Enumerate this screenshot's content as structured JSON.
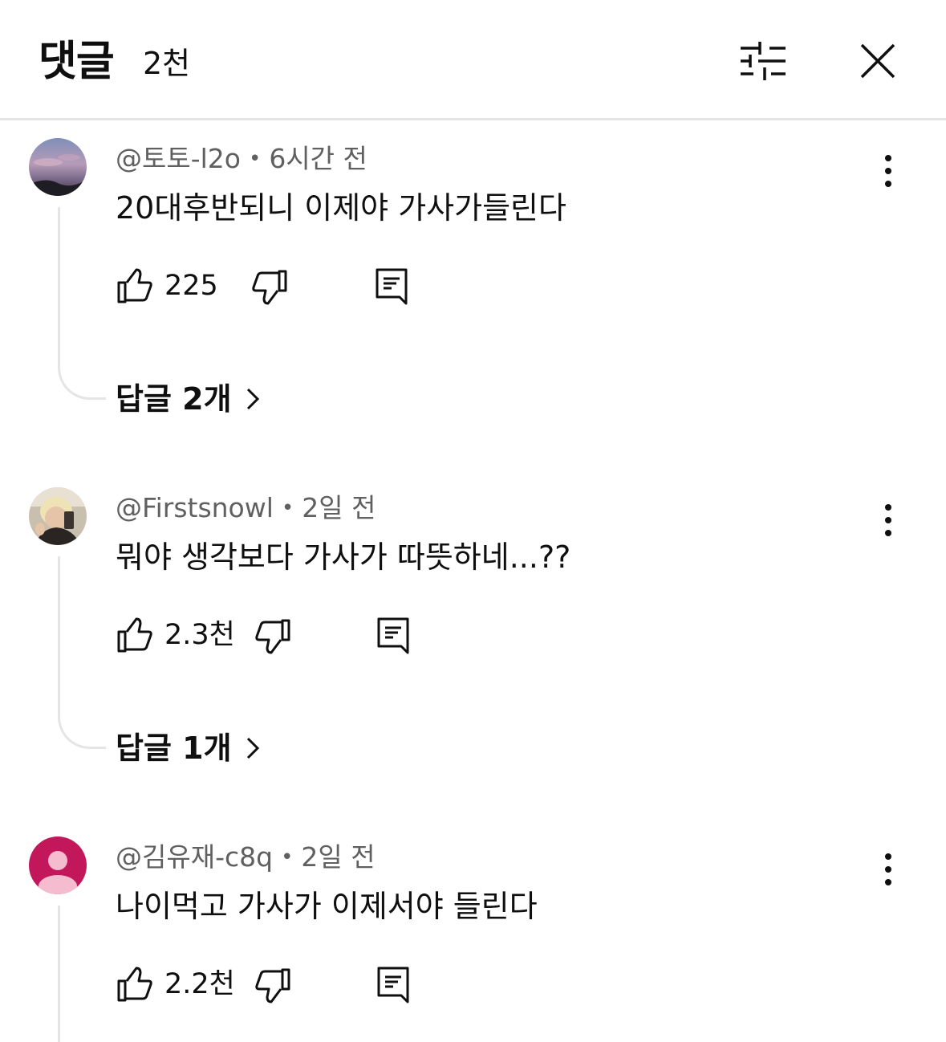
{
  "header": {
    "title": "댓글",
    "count": "2천",
    "filter_icon": "sliders-icon",
    "close_icon": "close-icon"
  },
  "comments": [
    {
      "author": "@토토-l2o",
      "time": "6시간 전",
      "text": "20대후반되니 이제야 가사가들린다",
      "likes": "225",
      "replies": "답글 2개",
      "avatar": "sunset-sky-photo"
    },
    {
      "author": "@Firstsnowl",
      "time": "2일 전",
      "text": "뭐야 생각보다 가사가 따뜻하네...??",
      "likes": "2.3천",
      "replies": "답글 1개",
      "avatar": "person-selfie-photo"
    },
    {
      "author": "@김유재-c8q",
      "time": "2일 전",
      "text": "나이먹고 가사가 이제서야 들린다",
      "likes": "2.2천",
      "avatar": "default-person-avatar"
    }
  ],
  "colors": {
    "text_primary": "#0f0f0f",
    "text_secondary": "#606060",
    "divider": "#e5e5e5",
    "default_avatar_bg": "#c2185b",
    "default_avatar_fg": "#f5bcd0"
  },
  "dot_separator": "•"
}
